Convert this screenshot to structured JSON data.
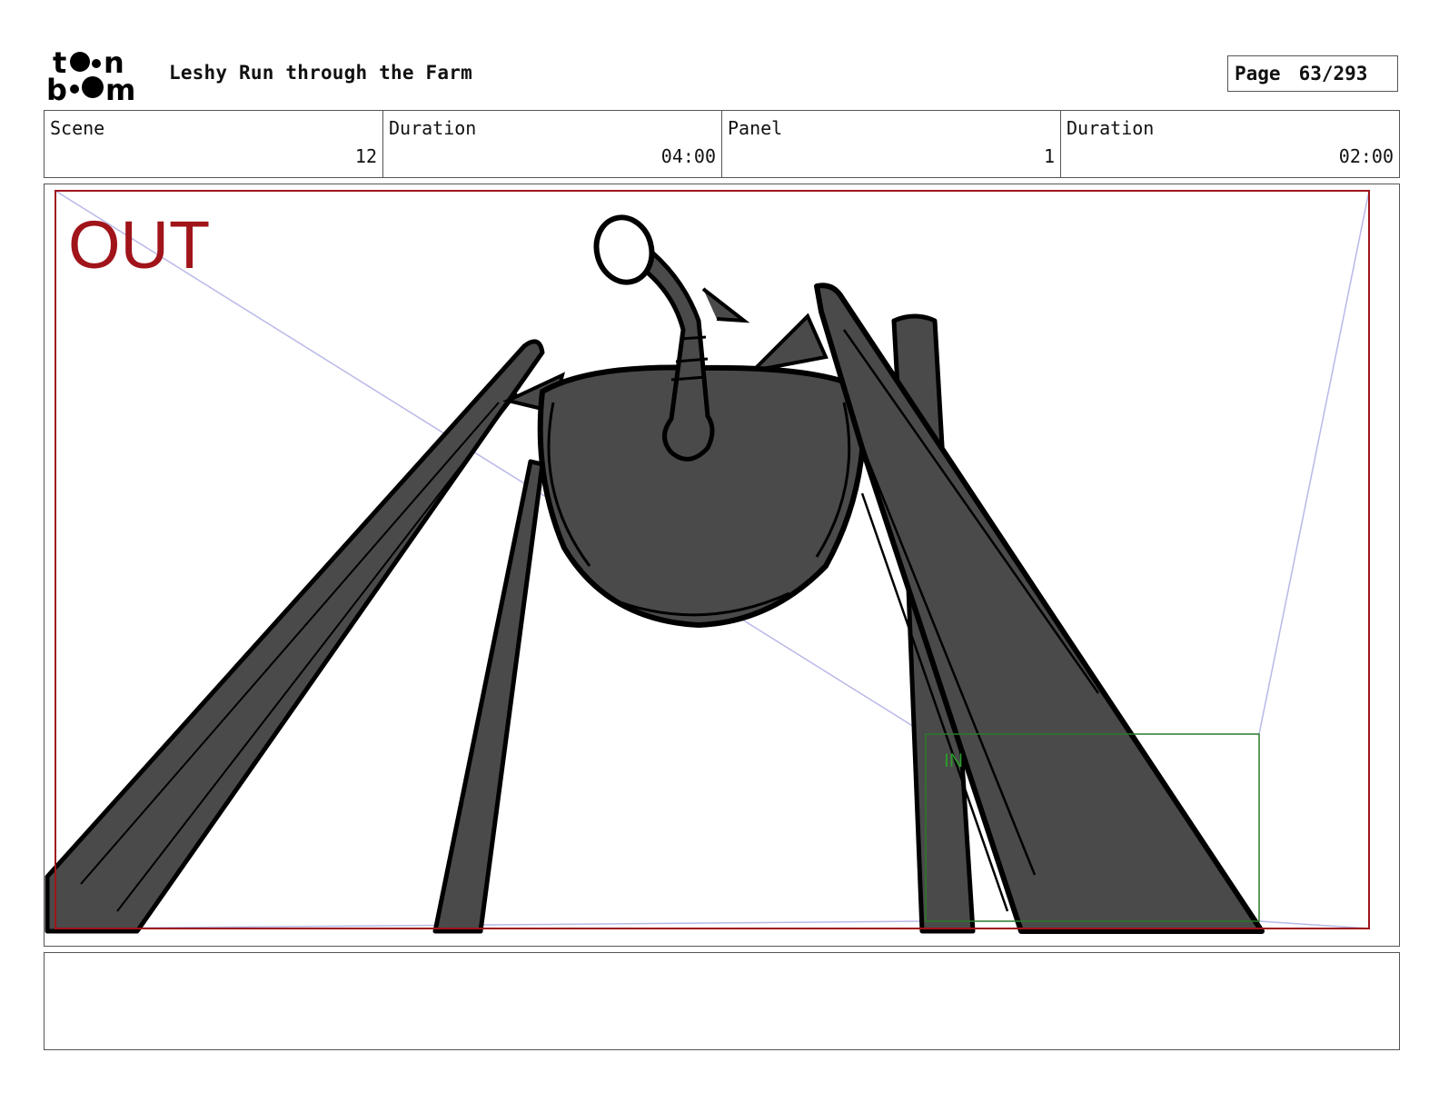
{
  "header": {
    "logo_text": "toon boom",
    "project_title": "Leshy Run through the Farm",
    "page_label": "Page",
    "page_value": "63/293"
  },
  "info": {
    "scene_label": "Scene",
    "scene_value": "12",
    "scene_duration_label": "Duration",
    "scene_duration_value": "04:00",
    "panel_label": "Panel",
    "panel_value": "1",
    "panel_duration_label": "Duration",
    "panel_duration_value": "02:00"
  },
  "panel": {
    "out_label": "OUT",
    "in_label": "IN",
    "out_frame_color": "#a0141a",
    "in_frame_color": "#2a7a2a",
    "guide_color": "#b8b8e8",
    "figure_fill": "#4a4a4a",
    "figure_stroke": "#000000"
  },
  "notes": {
    "text": ""
  }
}
